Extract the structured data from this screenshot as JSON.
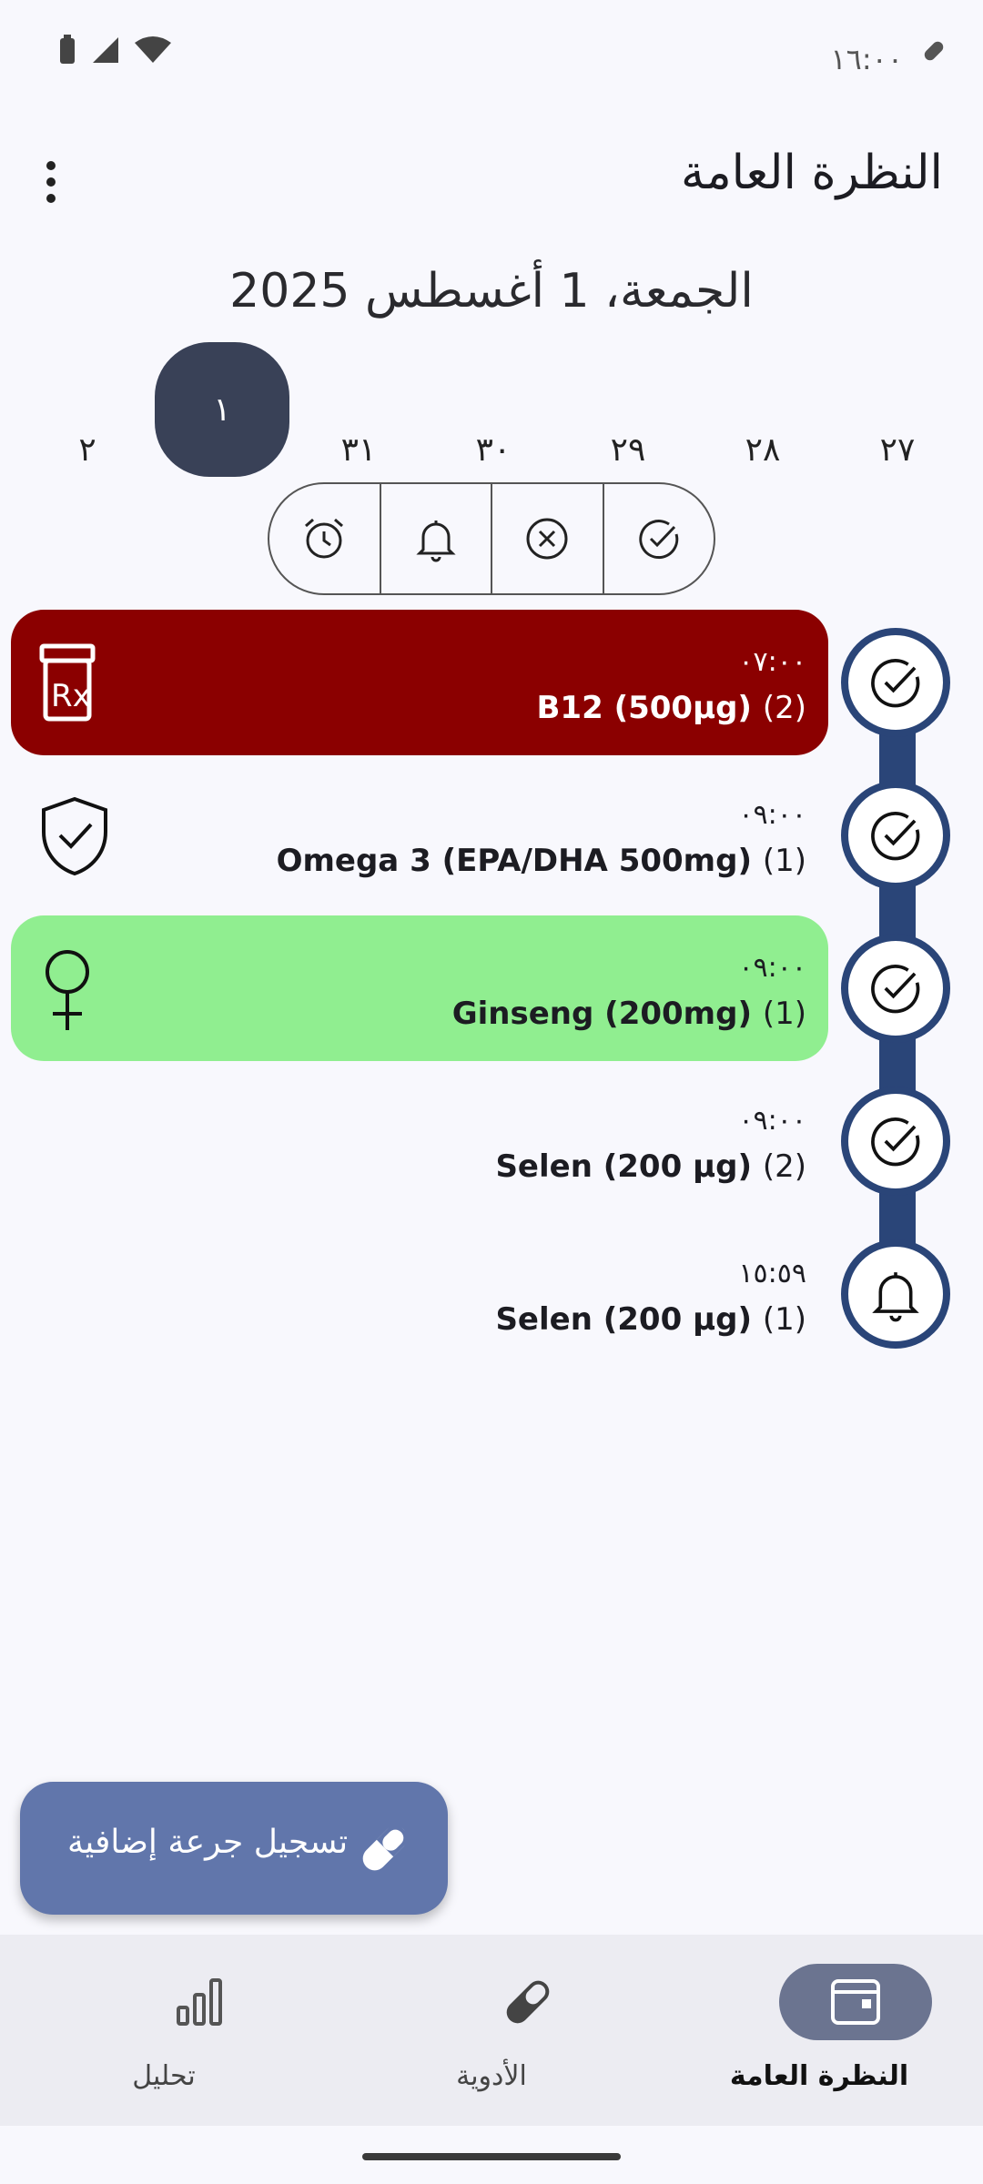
{
  "status_bar": {
    "time": "١٦:٠٠"
  },
  "header": {
    "title": "النظرة العامة",
    "menu_icon": "more-vert-icon"
  },
  "date_heading": "الجمعة، 1 أغسطس 2025",
  "days": [
    {
      "label": "٢",
      "selected": false
    },
    {
      "label": "١",
      "selected": true
    },
    {
      "label": "٣١",
      "selected": false
    },
    {
      "label": "٣٠",
      "selected": false
    },
    {
      "label": "٢٩",
      "selected": false
    },
    {
      "label": "٢٨",
      "selected": false
    },
    {
      "label": "٢٧",
      "selected": false
    }
  ],
  "filters": [
    "alarm-clock-icon",
    "bell-icon",
    "x-circle-icon",
    "check-circle-icon"
  ],
  "doses": [
    {
      "time": "٠٧:٠٠",
      "name": "B12 (500µg)",
      "count": "(2)",
      "status": "taken",
      "style": "red",
      "icon": "prescription-bottle-icon"
    },
    {
      "time": "٠٩:٠٠",
      "name": "Omega 3 (EPA/DHA 500mg)",
      "count": "(1)",
      "status": "taken",
      "style": "plain",
      "icon": "shield-check-icon"
    },
    {
      "time": "٠٩:٠٠",
      "name": "Ginseng (200mg)",
      "count": "(1)",
      "status": "taken",
      "style": "green",
      "icon": "female-symbol-icon"
    },
    {
      "time": "٠٩:٠٠",
      "name": "Selen (200 µg)",
      "count": "(2)",
      "status": "taken",
      "style": "plain",
      "icon": ""
    },
    {
      "time": "١٥:٥٩",
      "name": "Selen (200 µg)",
      "count": "(1)",
      "status": "pending",
      "style": "plain",
      "icon": ""
    }
  ],
  "fab": {
    "label": "تسجيل جرعة إضافية",
    "icon": "pill-icon"
  },
  "bottom_nav": [
    {
      "label": "تحليل",
      "icon": "bar-chart-icon",
      "active": false
    },
    {
      "label": "الأدوية",
      "icon": "pill-icon",
      "active": false
    },
    {
      "label": "النظرة العامة",
      "icon": "calendar-icon",
      "active": true
    }
  ],
  "colors": {
    "timeline": "#2a4578",
    "red_card": "#8b0000",
    "green_card": "#90ee90",
    "fab": "#6176ab"
  }
}
